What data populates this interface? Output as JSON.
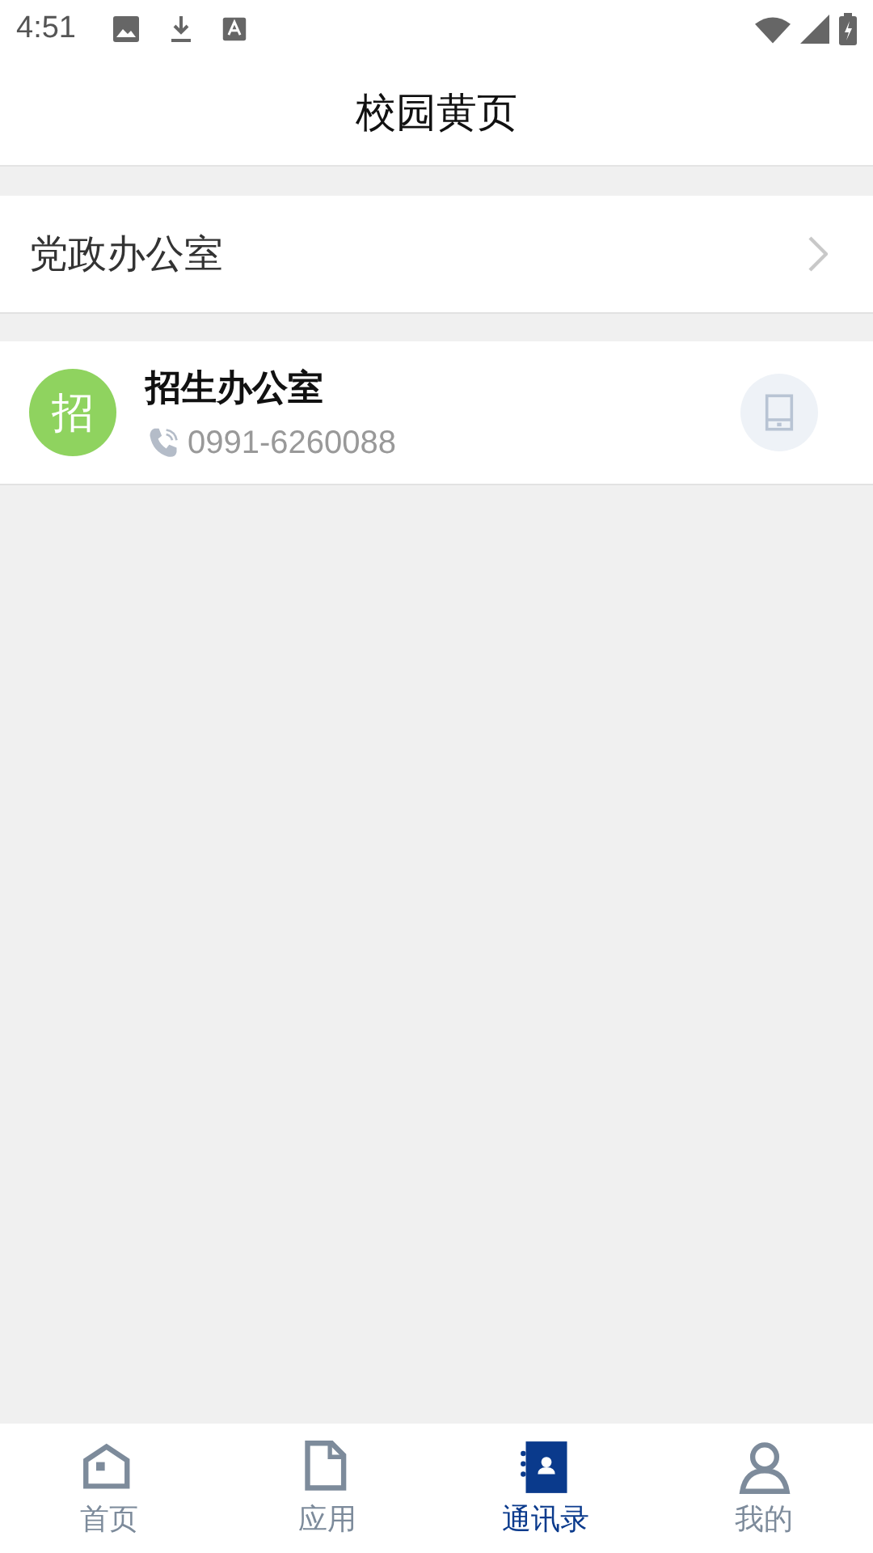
{
  "status_bar": {
    "time": "4:51"
  },
  "title": "校园黄页",
  "groups": [
    {
      "name": "党政办公室"
    }
  ],
  "contacts": [
    {
      "avatar_text": "招",
      "color": "#8fd35f",
      "name": "招生办公室",
      "phone": "0991-6260088"
    }
  ],
  "tabs": [
    {
      "kind": "home",
      "label": "首页",
      "selected": false
    },
    {
      "kind": "app",
      "label": "应用",
      "selected": false
    },
    {
      "kind": "contacts",
      "label": "通讯录",
      "selected": true
    },
    {
      "kind": "profile",
      "label": "我的",
      "selected": false
    }
  ]
}
